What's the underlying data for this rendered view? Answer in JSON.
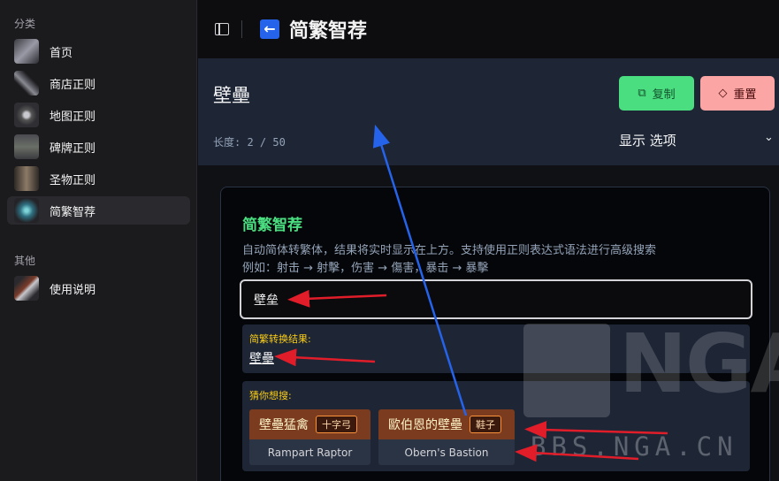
{
  "sidebar": {
    "section_main": "分类",
    "items": [
      {
        "label": "首页",
        "icon": "home-item-icon"
      },
      {
        "label": "商店正则",
        "icon": "shop-item-icon"
      },
      {
        "label": "地图正则",
        "icon": "map-item-icon"
      },
      {
        "label": "碑牌正则",
        "icon": "tablet-item-icon"
      },
      {
        "label": "圣物正则",
        "icon": "relic-item-icon"
      },
      {
        "label": "简繁智荐",
        "icon": "convert-item-icon",
        "active": true
      }
    ],
    "section_other": "其他",
    "other_items": [
      {
        "label": "使用说明",
        "icon": "manual-item-icon"
      }
    ]
  },
  "header": {
    "title": "简繁智荐",
    "back_icon": "←"
  },
  "result": {
    "text": "壁壘",
    "length": "长度: 2 / 50",
    "copy_label": "复制",
    "reset_label": "重置",
    "options_label": "显示 选项"
  },
  "card": {
    "title": "简繁智荐",
    "description": "自动简体转繁体，结果将实时显示在上方。支持使用正则表达式语法进行高级搜索",
    "example": "例如：射击 → 射擊，伤害 → 傷害，暴击 → 暴擊",
    "input_value": "壁垒",
    "conversion_label": "简繁转换结果:",
    "conversion_value": "壁壘",
    "suggest_label": "猜你想搜:",
    "suggestions": [
      {
        "name": "壁壘猛禽",
        "tag": "十字弓",
        "english": "Rampart Raptor"
      },
      {
        "name": "歐伯恩的壁壘",
        "tag": "鞋子",
        "english": "Obern's Bastion"
      }
    ]
  },
  "watermark": {
    "logo_text": "NGA",
    "site": "BBS.NGA.CN"
  },
  "colors": {
    "accent_green": "#4ade80",
    "reset_pink": "#fca5a5",
    "label_yellow": "#facc15",
    "suggestion_brown": "#7a3b1f",
    "annotation_red": "#e11d2a",
    "annotation_blue": "#2563eb"
  }
}
